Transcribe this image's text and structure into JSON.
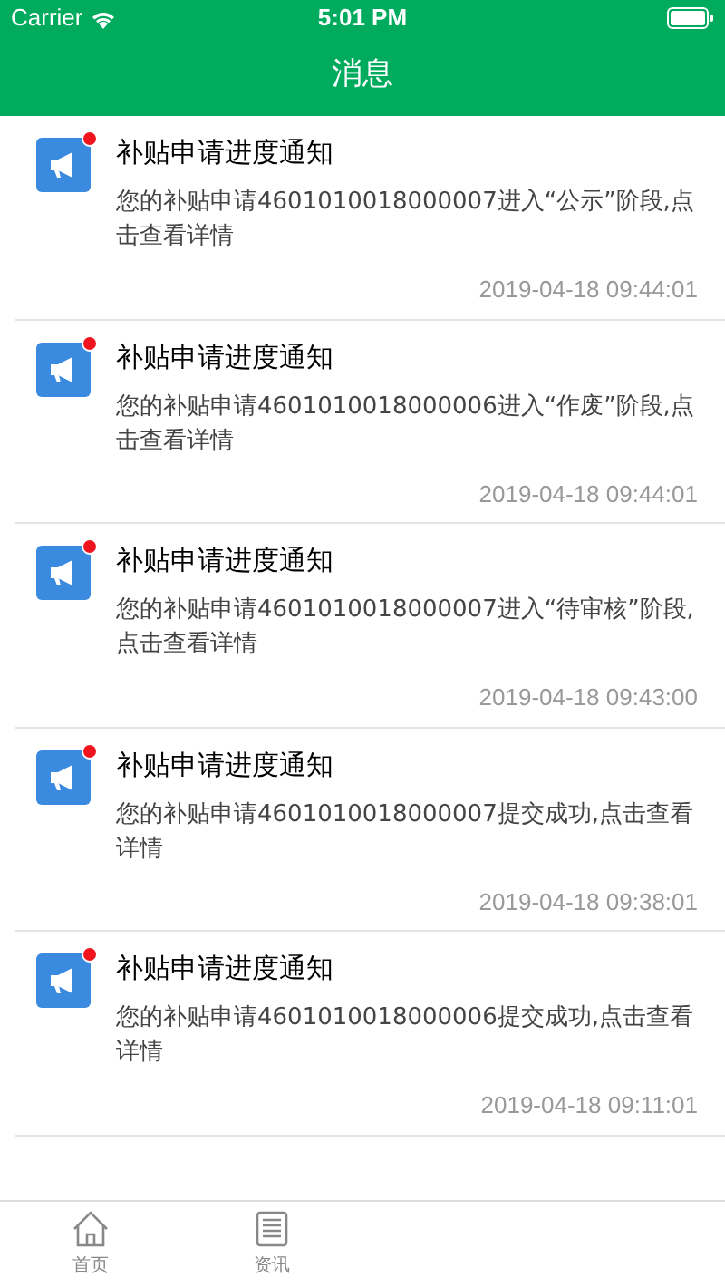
{
  "status_bar": {
    "carrier": "Carrier",
    "time": "5:01 PM"
  },
  "nav": {
    "title": "消息"
  },
  "messages": [
    {
      "title": "补贴申请进度通知",
      "body": "您的补贴申请4601010018000007进入“公示”阶段,点击查看详情",
      "time": "2019-04-18 09:44:01",
      "unread": true
    },
    {
      "title": "补贴申请进度通知",
      "body": "您的补贴申请4601010018000006进入“作废”阶段,点击查看详情",
      "time": "2019-04-18 09:44:01",
      "unread": true
    },
    {
      "title": "补贴申请进度通知",
      "body": "您的补贴申请4601010018000007进入“待审核”阶段,点击查看详情",
      "time": "2019-04-18 09:43:00",
      "unread": true
    },
    {
      "title": "补贴申请进度通知",
      "body": "您的补贴申请4601010018000007提交成功,点击查看详情",
      "time": "2019-04-18 09:38:01",
      "unread": true
    },
    {
      "title": "补贴申请进度通知",
      "body": "您的补贴申请4601010018000006提交成功,点击查看详情",
      "time": "2019-04-18 09:11:01",
      "unread": true
    }
  ],
  "tabs": [
    {
      "label": "首页",
      "kind": "home",
      "selected": false
    },
    {
      "label": "资讯",
      "kind": "news",
      "selected": false
    }
  ]
}
